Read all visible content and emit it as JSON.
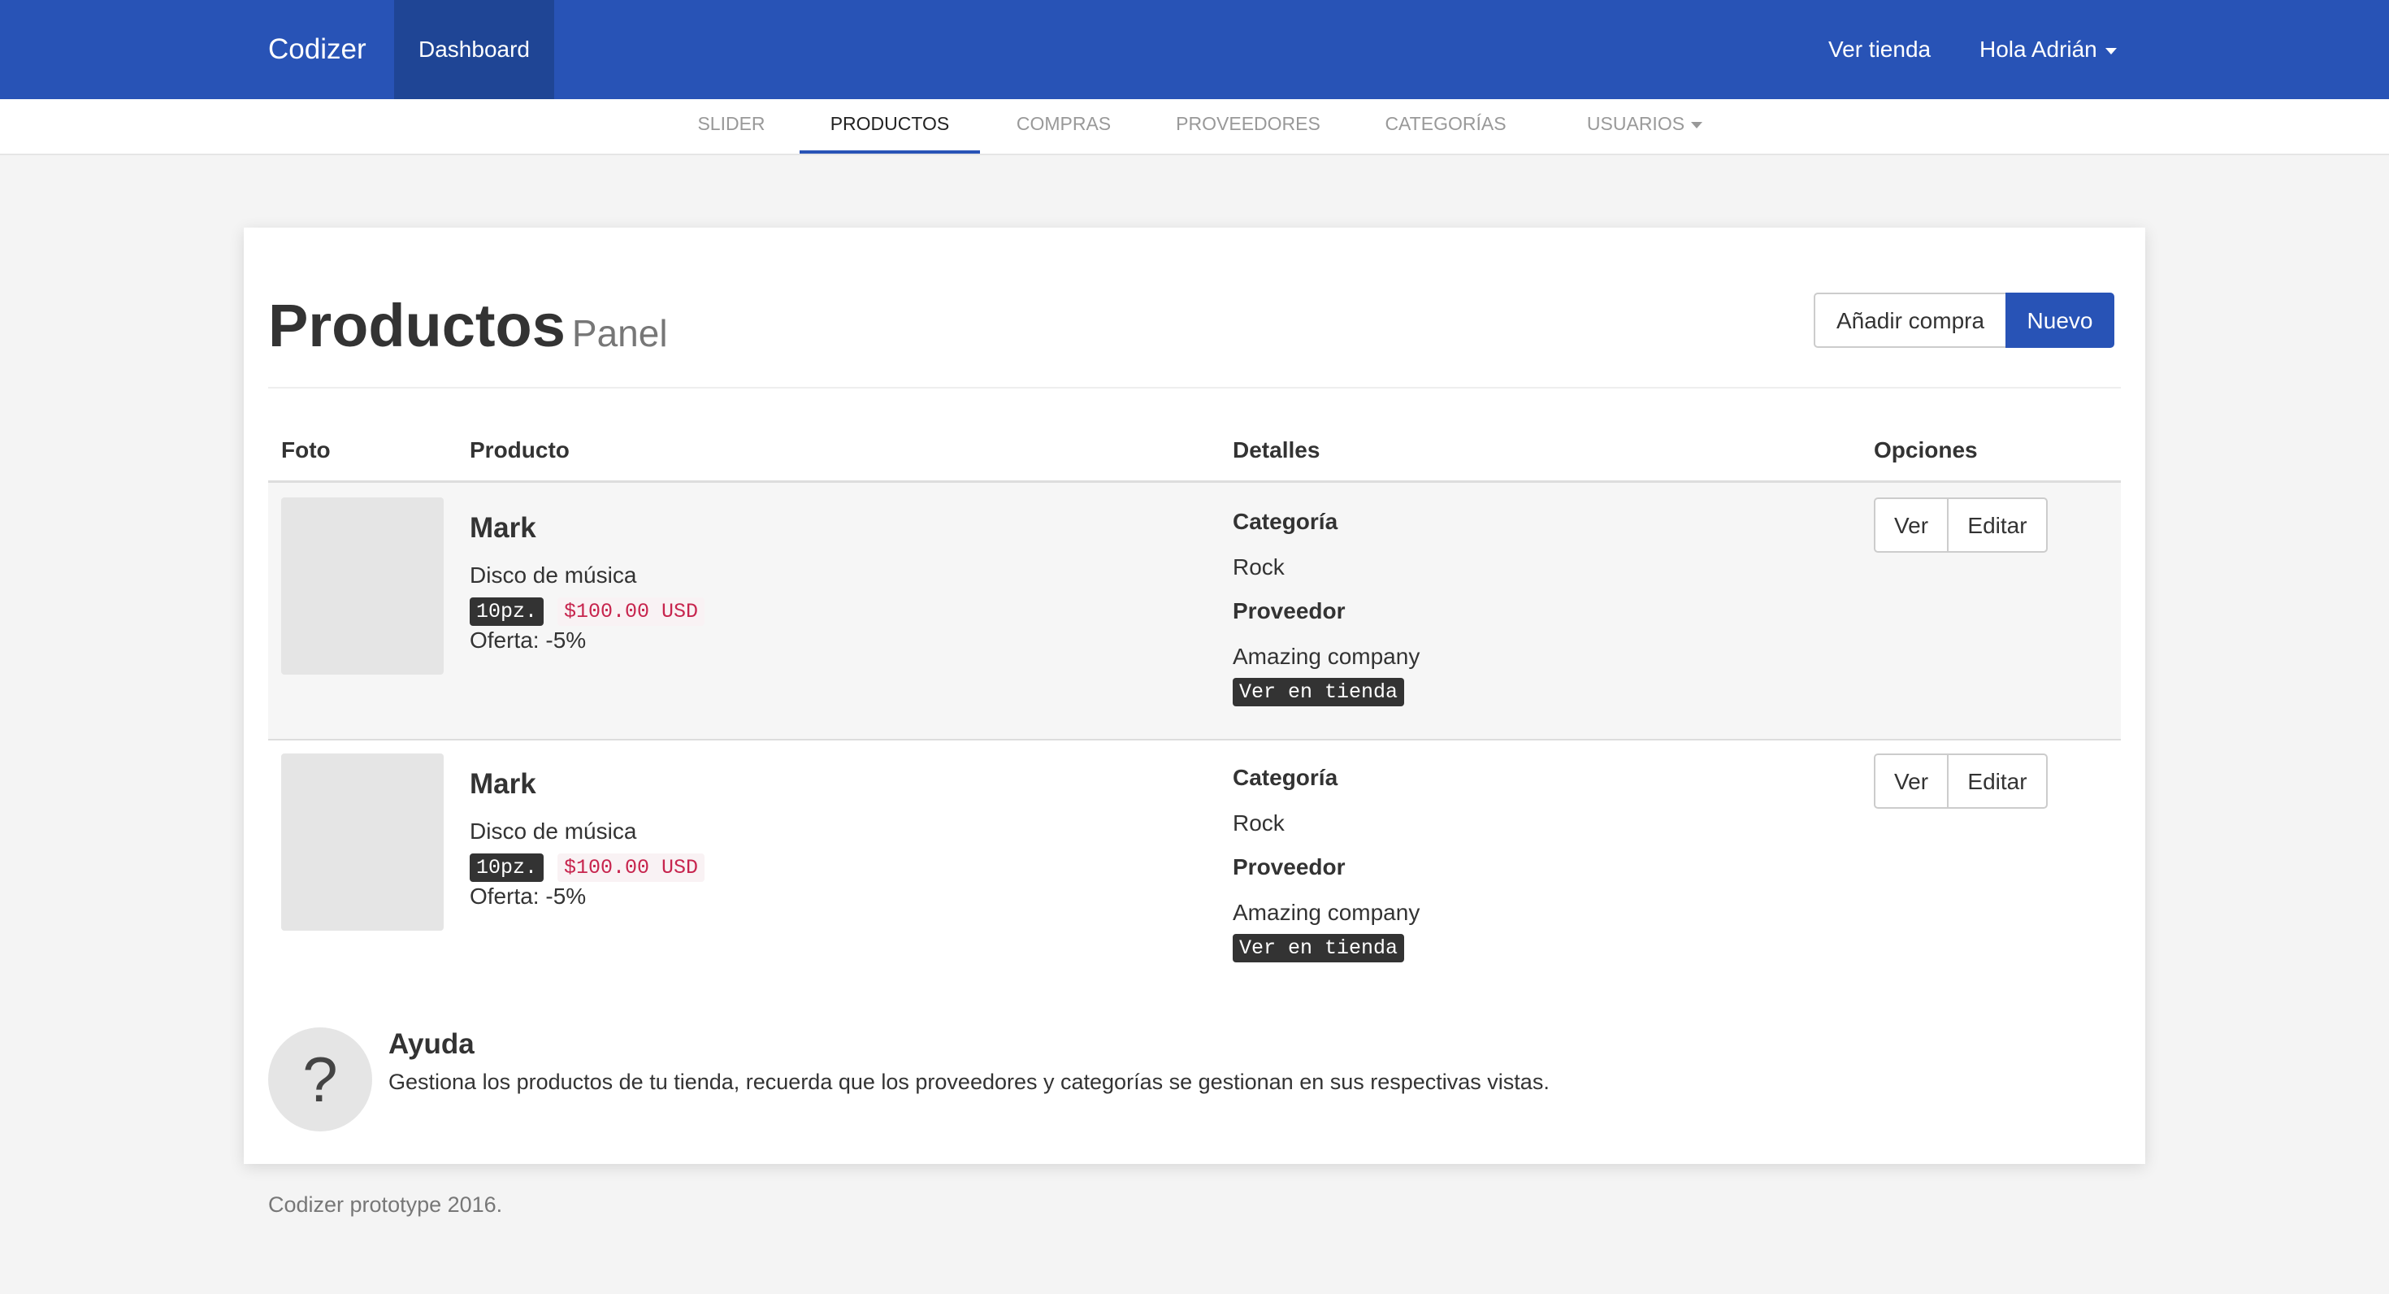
{
  "navbar": {
    "brand": "Codizer",
    "active": "Dashboard",
    "view_store": "Ver tienda",
    "user_greeting": "Hola Adrián"
  },
  "tabs": [
    {
      "label": "SLIDER"
    },
    {
      "label": "PRODUCTOS",
      "active": true
    },
    {
      "label": "COMPRAS"
    },
    {
      "label": "PROVEEDORES"
    },
    {
      "label": "CATEGORÍAS"
    },
    {
      "label": "USUARIOS",
      "dropdown": true
    }
  ],
  "panel": {
    "title": "Productos",
    "subtitle": "Panel",
    "add_purchase_button": "Añadir compra",
    "new_button": "Nuevo"
  },
  "table": {
    "headers": {
      "photo": "Foto",
      "product": "Producto",
      "details": "Detalles",
      "options": "Opciones"
    },
    "rows": [
      {
        "name": "Mark",
        "description": "Disco de música",
        "stock": "10pz.",
        "price": "$100.00 USD",
        "offer": "Oferta: -5%",
        "category_label": "Categoría",
        "category": "Rock",
        "supplier_label": "Proveedor",
        "supplier": "Amazing company",
        "store_link": "Ver en tienda",
        "view_button": "Ver",
        "edit_button": "Editar"
      },
      {
        "name": "Mark",
        "description": "Disco de música",
        "stock": "10pz.",
        "price": "$100.00 USD",
        "offer": "Oferta: -5%",
        "category_label": "Categoría",
        "category": "Rock",
        "supplier_label": "Proveedor",
        "supplier": "Amazing company",
        "store_link": "Ver en tienda",
        "view_button": "Ver",
        "edit_button": "Editar"
      }
    ]
  },
  "help": {
    "icon": "?",
    "title": "Ayuda",
    "text": "Gestiona los productos de tu tienda, recuerda que los proveedores y categorías se gestionan en sus respectivas vistas."
  },
  "footer": "Codizer prototype 2016.",
  "colors": {
    "brand_blue": "#2853b6",
    "active_nav": "#1f4595",
    "price_red": "#c7254e"
  }
}
